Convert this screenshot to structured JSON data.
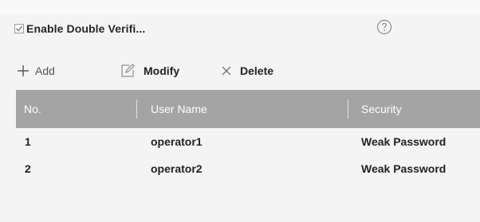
{
  "options": {
    "enable_double_verification": {
      "label": "Enable Double Verifi...",
      "checked": true
    },
    "help_icon": "question-circle-icon"
  },
  "toolbar": {
    "add_label": "Add",
    "modify_label": "Modify",
    "delete_label": "Delete"
  },
  "table": {
    "columns": [
      "No.",
      "User Name",
      "Security"
    ],
    "rows": [
      {
        "no": "1",
        "user_name": "operator1",
        "security": "Weak Password"
      },
      {
        "no": "2",
        "user_name": "operator2",
        "security": "Weak Password"
      }
    ]
  },
  "colors": {
    "header_bg": "#a4a4a4",
    "header_text": "#ffffff",
    "page_bg": "#f4f4f4"
  }
}
